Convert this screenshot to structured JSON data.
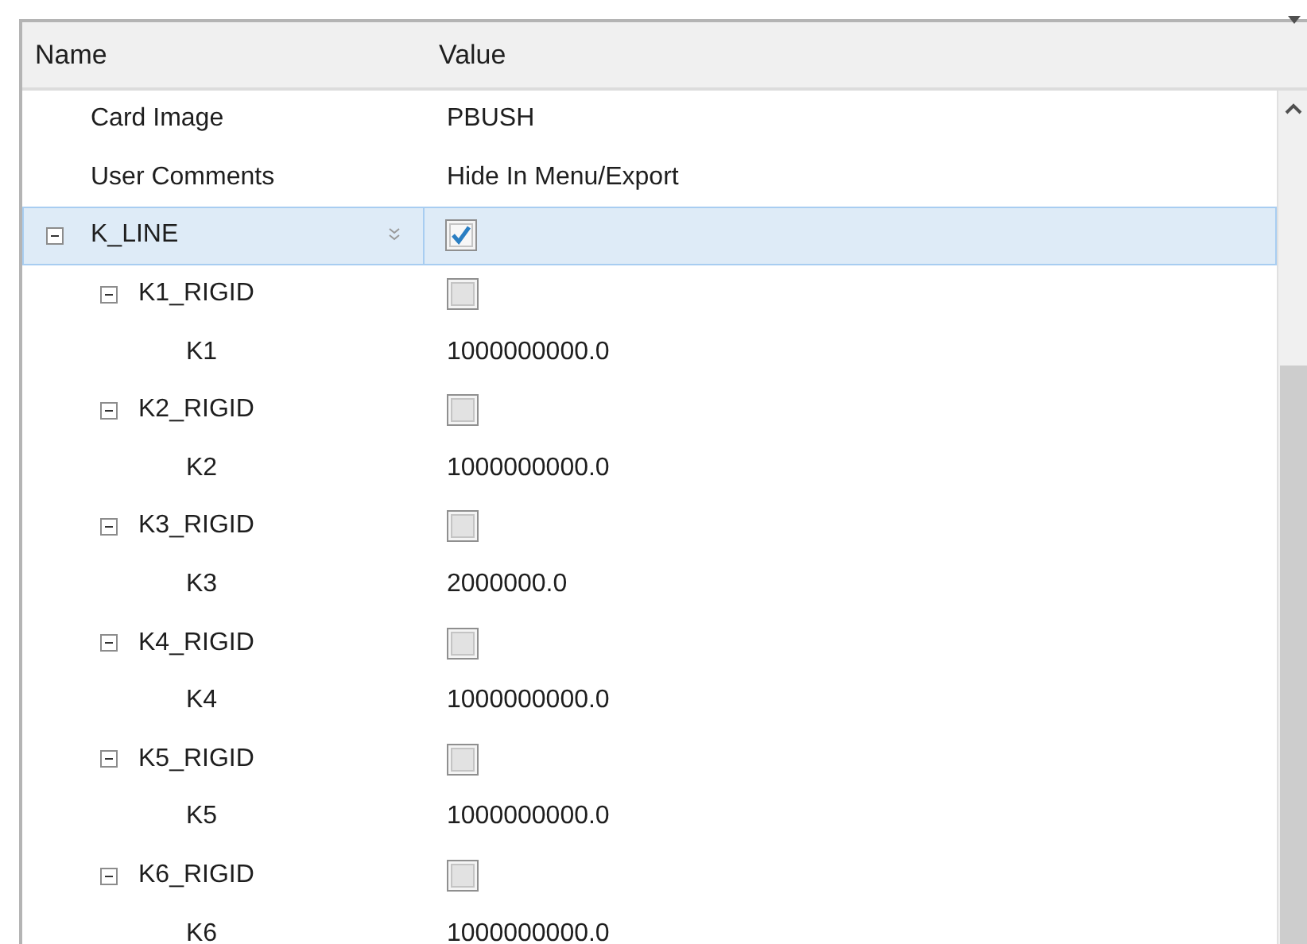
{
  "columns": [
    "Name",
    "Value"
  ],
  "rows": [
    {
      "name": "Card Image",
      "kind": "text",
      "value": "PBUSH",
      "selected": false
    },
    {
      "name": "User Comments",
      "kind": "text",
      "value": "Hide In Menu/Export",
      "selected": false
    },
    {
      "name": "K_LINE",
      "kind": "checkbox",
      "checked": true,
      "selected": true,
      "expanded": true,
      "children": [
        {
          "name": "K1_RIGID",
          "kind": "checkbox",
          "checked": false,
          "selected": false,
          "expanded": true,
          "children": [
            {
              "name": "K1",
              "kind": "text",
              "value": "1000000000.0",
              "selected": false
            }
          ]
        },
        {
          "name": "K2_RIGID",
          "kind": "checkbox",
          "checked": false,
          "selected": false,
          "expanded": true,
          "children": [
            {
              "name": "K2",
              "kind": "text",
              "value": "1000000000.0",
              "selected": false
            }
          ]
        },
        {
          "name": "K3_RIGID",
          "kind": "checkbox",
          "checked": false,
          "selected": false,
          "expanded": true,
          "children": [
            {
              "name": "K3",
              "kind": "text",
              "value": "2000000.0",
              "selected": false
            }
          ]
        },
        {
          "name": "K4_RIGID",
          "kind": "checkbox",
          "checked": false,
          "selected": false,
          "expanded": true,
          "children": [
            {
              "name": "K4",
              "kind": "text",
              "value": "1000000000.0",
              "selected": false
            }
          ]
        },
        {
          "name": "K5_RIGID",
          "kind": "checkbox",
          "checked": false,
          "selected": false,
          "expanded": true,
          "children": [
            {
              "name": "K5",
              "kind": "text",
              "value": "1000000000.0",
              "selected": false
            }
          ]
        },
        {
          "name": "K6_RIGID",
          "kind": "checkbox",
          "checked": false,
          "selected": false,
          "expanded": true,
          "children": [
            {
              "name": "K6",
              "kind": "text",
              "value": "1000000000.0",
              "selected": false
            }
          ]
        }
      ]
    }
  ]
}
